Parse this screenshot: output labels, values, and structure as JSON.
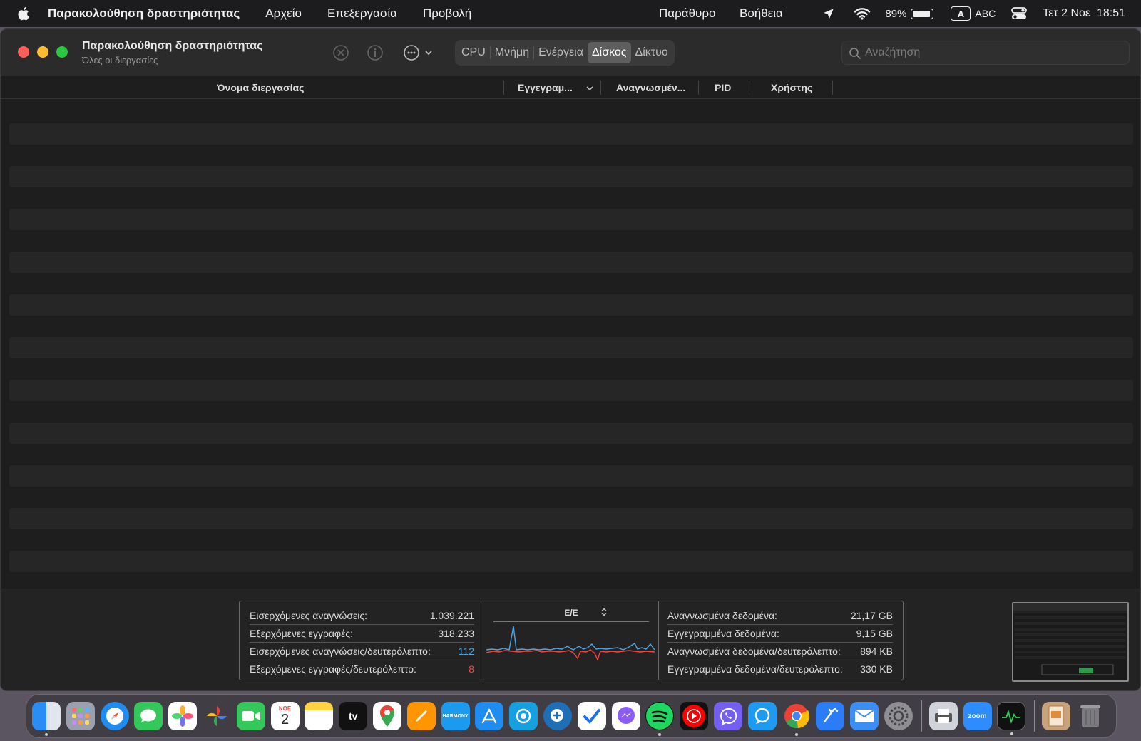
{
  "menubar": {
    "app_name": "Παρακολούθηση δραστηριότητας",
    "items": [
      "Αρχείο",
      "Επεξεργασία",
      "Προβολή",
      "Παράθυρο",
      "Βοήθεια"
    ],
    "battery": "89%",
    "input_letter": "A",
    "input_source": "ABC",
    "clock": "Τετ 2 Νοε  18:51"
  },
  "window": {
    "title": "Παρακολούθηση δραστηριότητας",
    "subtitle": "Όλες οι διεργασίες",
    "tabs": [
      "CPU",
      "Μνήμη",
      "Ενέργεια",
      "Δίσκος",
      "Δίκτυο"
    ],
    "active_tab": "Δίσκος",
    "search_placeholder": "Αναζήτηση"
  },
  "table": {
    "columns": [
      "Όνομα διεργασίας",
      "Εγγεγραμ...",
      "Αναγνωσμέν...",
      "PID",
      "Χρήστης"
    ]
  },
  "stats": {
    "left": [
      {
        "label": "Εισερχόμενες αναγνώσεις:",
        "value": "1.039.221",
        "color": ""
      },
      {
        "label": "Εξερχόμενες εγγραφές:",
        "value": "318.233",
        "color": ""
      },
      {
        "label": "Εισερχόμενες αναγνώσεις/δευτερόλεπτο:",
        "value": "112",
        "color": "#4aa8e8"
      },
      {
        "label": "Εξερχόμενες εγγραφές/δευτερόλεπτο:",
        "value": "8",
        "color": "#ff453a"
      }
    ],
    "graph_label": "Ε/Ε",
    "right": [
      {
        "label": "Αναγνωσμένα δεδομένα:",
        "value": "21,17 GB"
      },
      {
        "label": "Εγγεγραμμένα δεδομένα:",
        "value": "9,15 GB"
      },
      {
        "label": "Αναγνωσμένα δεδομένα/δευτερόλεπτο:",
        "value": "894 KB"
      },
      {
        "label": "Εγγεγραμμένα δεδομένα/δευτερόλεπτο:",
        "value": "330 KB"
      }
    ]
  },
  "dock": {
    "calendar_month": "ΝΟΕ",
    "calendar_day": "2",
    "tv_label": "tv",
    "harmony_label": "HARMONY",
    "zoom_label": "zoom"
  }
}
